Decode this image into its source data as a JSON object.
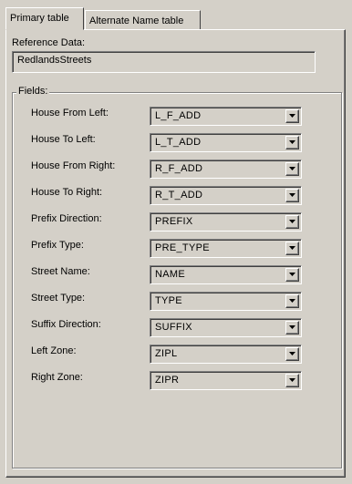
{
  "tabs": [
    {
      "label": "Primary table",
      "active": true
    },
    {
      "label": "Alternate Name table",
      "active": false
    }
  ],
  "reference": {
    "label": "Reference Data:",
    "value": "RedlandsStreets"
  },
  "fields": {
    "legend": "Fields:",
    "rows": [
      {
        "label": "House From Left:",
        "value": "L_F_ADD"
      },
      {
        "label": "House To Left:",
        "value": "L_T_ADD"
      },
      {
        "label": "House From Right:",
        "value": "R_F_ADD"
      },
      {
        "label": "House To Right:",
        "value": "R_T_ADD"
      },
      {
        "label": "Prefix Direction:",
        "value": "PREFIX"
      },
      {
        "label": "Prefix Type:",
        "value": "PRE_TYPE"
      },
      {
        "label": "Street Name:",
        "value": "NAME"
      },
      {
        "label": "Street Type:",
        "value": "TYPE"
      },
      {
        "label": "Suffix Direction:",
        "value": "SUFFIX"
      },
      {
        "label": "Left Zone:",
        "value": "ZIPL"
      },
      {
        "label": "Right Zone:",
        "value": "ZIPR"
      }
    ]
  },
  "icons": {
    "dropdown": "chevron-down-icon"
  },
  "colors": {
    "window_face": "#d4d0c8",
    "shadow": "#808080",
    "dark_shadow": "#404040",
    "highlight": "#ffffff"
  }
}
